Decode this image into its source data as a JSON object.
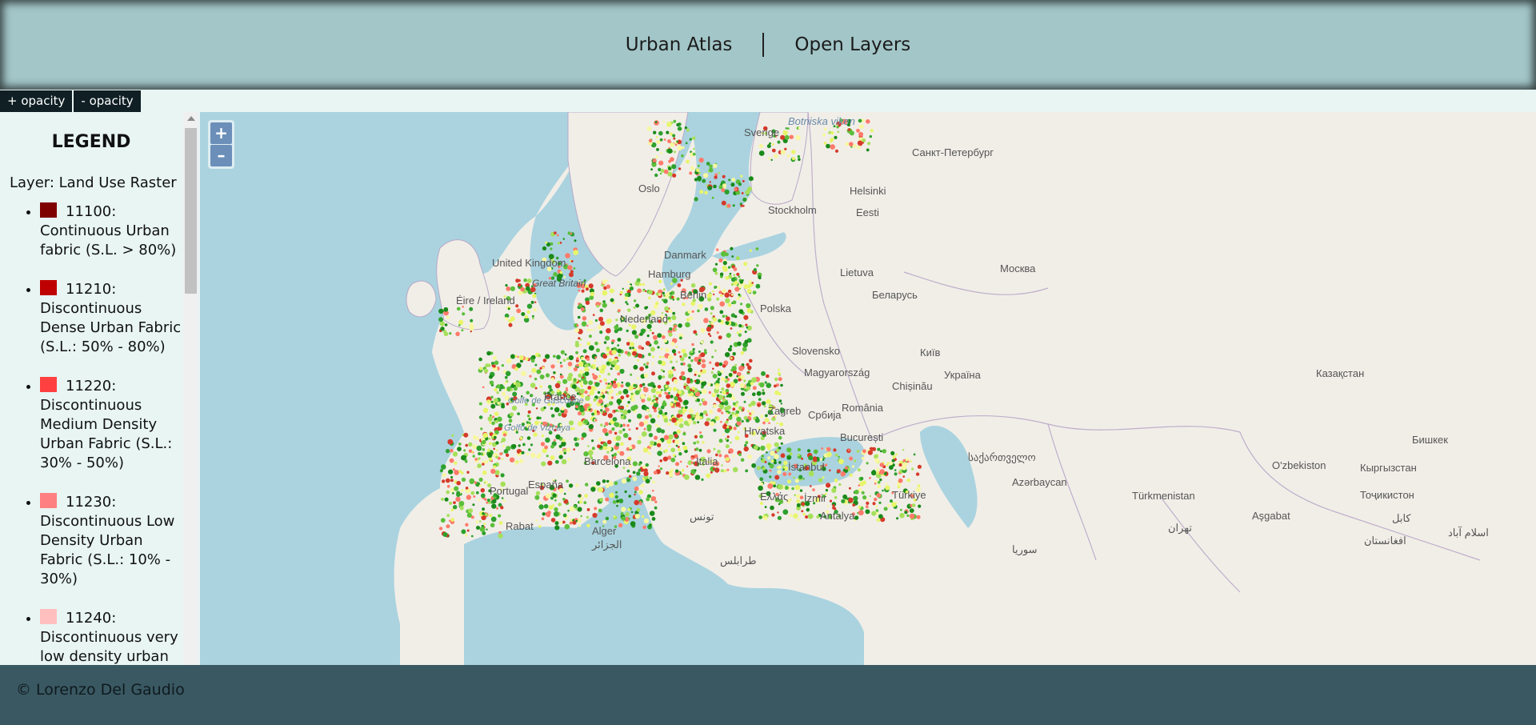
{
  "header": {
    "nav": [
      {
        "label": "Urban Atlas"
      },
      {
        "label": "Open Layers"
      }
    ]
  },
  "opacity_controls": {
    "increase_label": "+ opacity",
    "decrease_label": "- opacity"
  },
  "legend": {
    "title": "LEGEND",
    "layer_label": "Layer: Land Use Raster",
    "items": [
      {
        "code": "11100:",
        "text": "Continuous Urban fabric (S.L. > 80%)",
        "color": "#7f0000"
      },
      {
        "code": "11210:",
        "text": "Discontinuous Dense Urban Fabric (S.L.: 50% - 80%)",
        "color": "#bf0000"
      },
      {
        "code": "11220:",
        "text": "Discontinuous Medium Density Urban Fabric (S.L.: 30% - 50%)",
        "color": "#ff4040"
      },
      {
        "code": "11230:",
        "text": "Discontinuous Low Density Urban Fabric (S.L.: 10% - 30%)",
        "color": "#ff8080"
      },
      {
        "code": "11240:",
        "text": "Discontinuous very low density urban fabric",
        "color": "#ffbfbf"
      }
    ]
  },
  "map": {
    "zoom_in": "+",
    "zoom_out": "–",
    "labels": [
      {
        "text": "Sverige"
      },
      {
        "text": "Botniska viken"
      },
      {
        "text": "Санкт-Петербург"
      },
      {
        "text": "Helsinki"
      },
      {
        "text": "Stockholm"
      },
      {
        "text": "Eesti"
      },
      {
        "text": "Danmark"
      },
      {
        "text": "United Kingdom"
      },
      {
        "text": "Great Britain"
      },
      {
        "text": "Éire / Ireland"
      },
      {
        "text": "Lietuva"
      },
      {
        "text": "Москва"
      },
      {
        "text": "Беларусь"
      },
      {
        "text": "Київ"
      },
      {
        "text": "Україна"
      },
      {
        "text": "Казақстан"
      },
      {
        "text": "Chișinău"
      },
      {
        "text": "România"
      },
      {
        "text": "Golfe de Gascogne"
      },
      {
        "text": "Golfo de Vizcaya"
      },
      {
        "text": "France"
      },
      {
        "text": "Hrvatska"
      },
      {
        "text": "Zagreb"
      },
      {
        "text": "București"
      },
      {
        "text": "Italia"
      },
      {
        "text": "Barcelona"
      },
      {
        "text": "Portugal"
      },
      {
        "text": "España"
      },
      {
        "text": "İstanbul"
      },
      {
        "text": "Ελλάς"
      },
      {
        "text": "İzmir"
      },
      {
        "text": "Türkiye"
      },
      {
        "text": "Antalya"
      },
      {
        "text": "საქართველო"
      },
      {
        "text": "Azərbaycan"
      },
      {
        "text": "Türkmenistan"
      },
      {
        "text": "O'zbekiston"
      },
      {
        "text": "Бишкек"
      },
      {
        "text": "Кыргызстан"
      },
      {
        "text": "Тоҷикистон"
      },
      {
        "text": "Aşgabat"
      },
      {
        "text": "Rabat"
      },
      {
        "text": "Alger"
      },
      {
        "text": "الجزائر"
      },
      {
        "text": "تونس"
      },
      {
        "text": "طرابلس"
      },
      {
        "text": "سوريا"
      },
      {
        "text": "تهران"
      },
      {
        "text": "کابل"
      },
      {
        "text": "افغانستان"
      },
      {
        "text": "اسلام آباد"
      },
      {
        "text": "Србија"
      },
      {
        "text": "Slovensko"
      },
      {
        "text": "Magyarország"
      },
      {
        "text": "Polska"
      },
      {
        "text": "Berlin"
      },
      {
        "text": "Nederland"
      },
      {
        "text": "Oslo"
      },
      {
        "text": "Hamburg"
      }
    ]
  },
  "footer": {
    "copyright": "© Lorenzo Del Gaudio"
  }
}
